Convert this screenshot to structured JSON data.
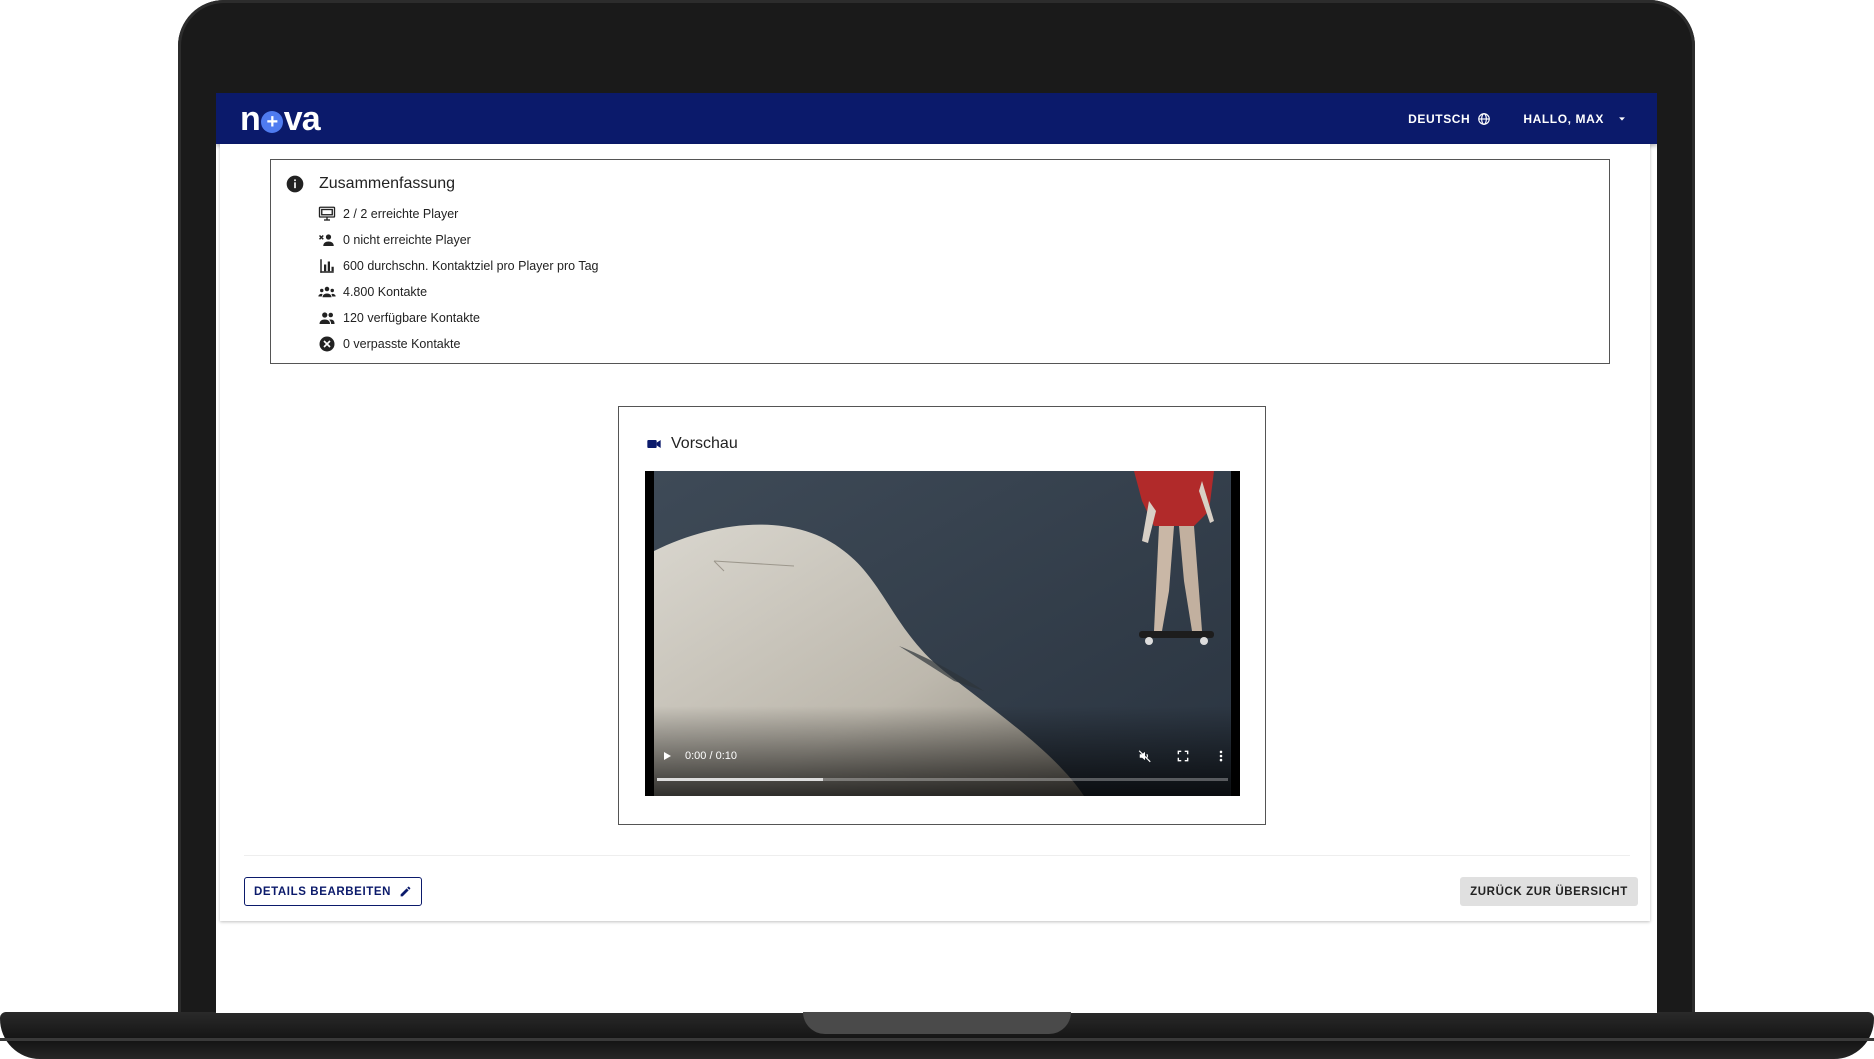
{
  "header": {
    "logo_left": "n",
    "logo_plus": "+",
    "logo_right": "va",
    "language_label": "DEUTSCH",
    "user_label": "HALLO, MAX"
  },
  "summary": {
    "title": "Zusammenfassung",
    "items": [
      {
        "icon": "monitor-icon",
        "text": "2 / 2 erreichte Player"
      },
      {
        "icon": "group-off-icon",
        "text": "0 nicht erreichte Player"
      },
      {
        "icon": "bar-chart-icon",
        "text": "600 durchschn. Kontaktziel pro Player pro Tag"
      },
      {
        "icon": "groups-icon",
        "text": "4.800 Kontakte"
      },
      {
        "icon": "people-icon",
        "text": "120 verfügbare Kontakte"
      },
      {
        "icon": "cancel-circle-icon",
        "text": "0 verpasste Kontakte"
      }
    ]
  },
  "preview": {
    "title": "Vorschau",
    "time": "0:00 / 0:10",
    "progress": 0.29
  },
  "actions": {
    "edit_label": "DETAILS BEARBEITEN",
    "back_label": "ZURÜCK ZUR ÜBERSICHT"
  },
  "colors": {
    "brand": "#0b1a6b",
    "accent": "#4f7bf0"
  }
}
